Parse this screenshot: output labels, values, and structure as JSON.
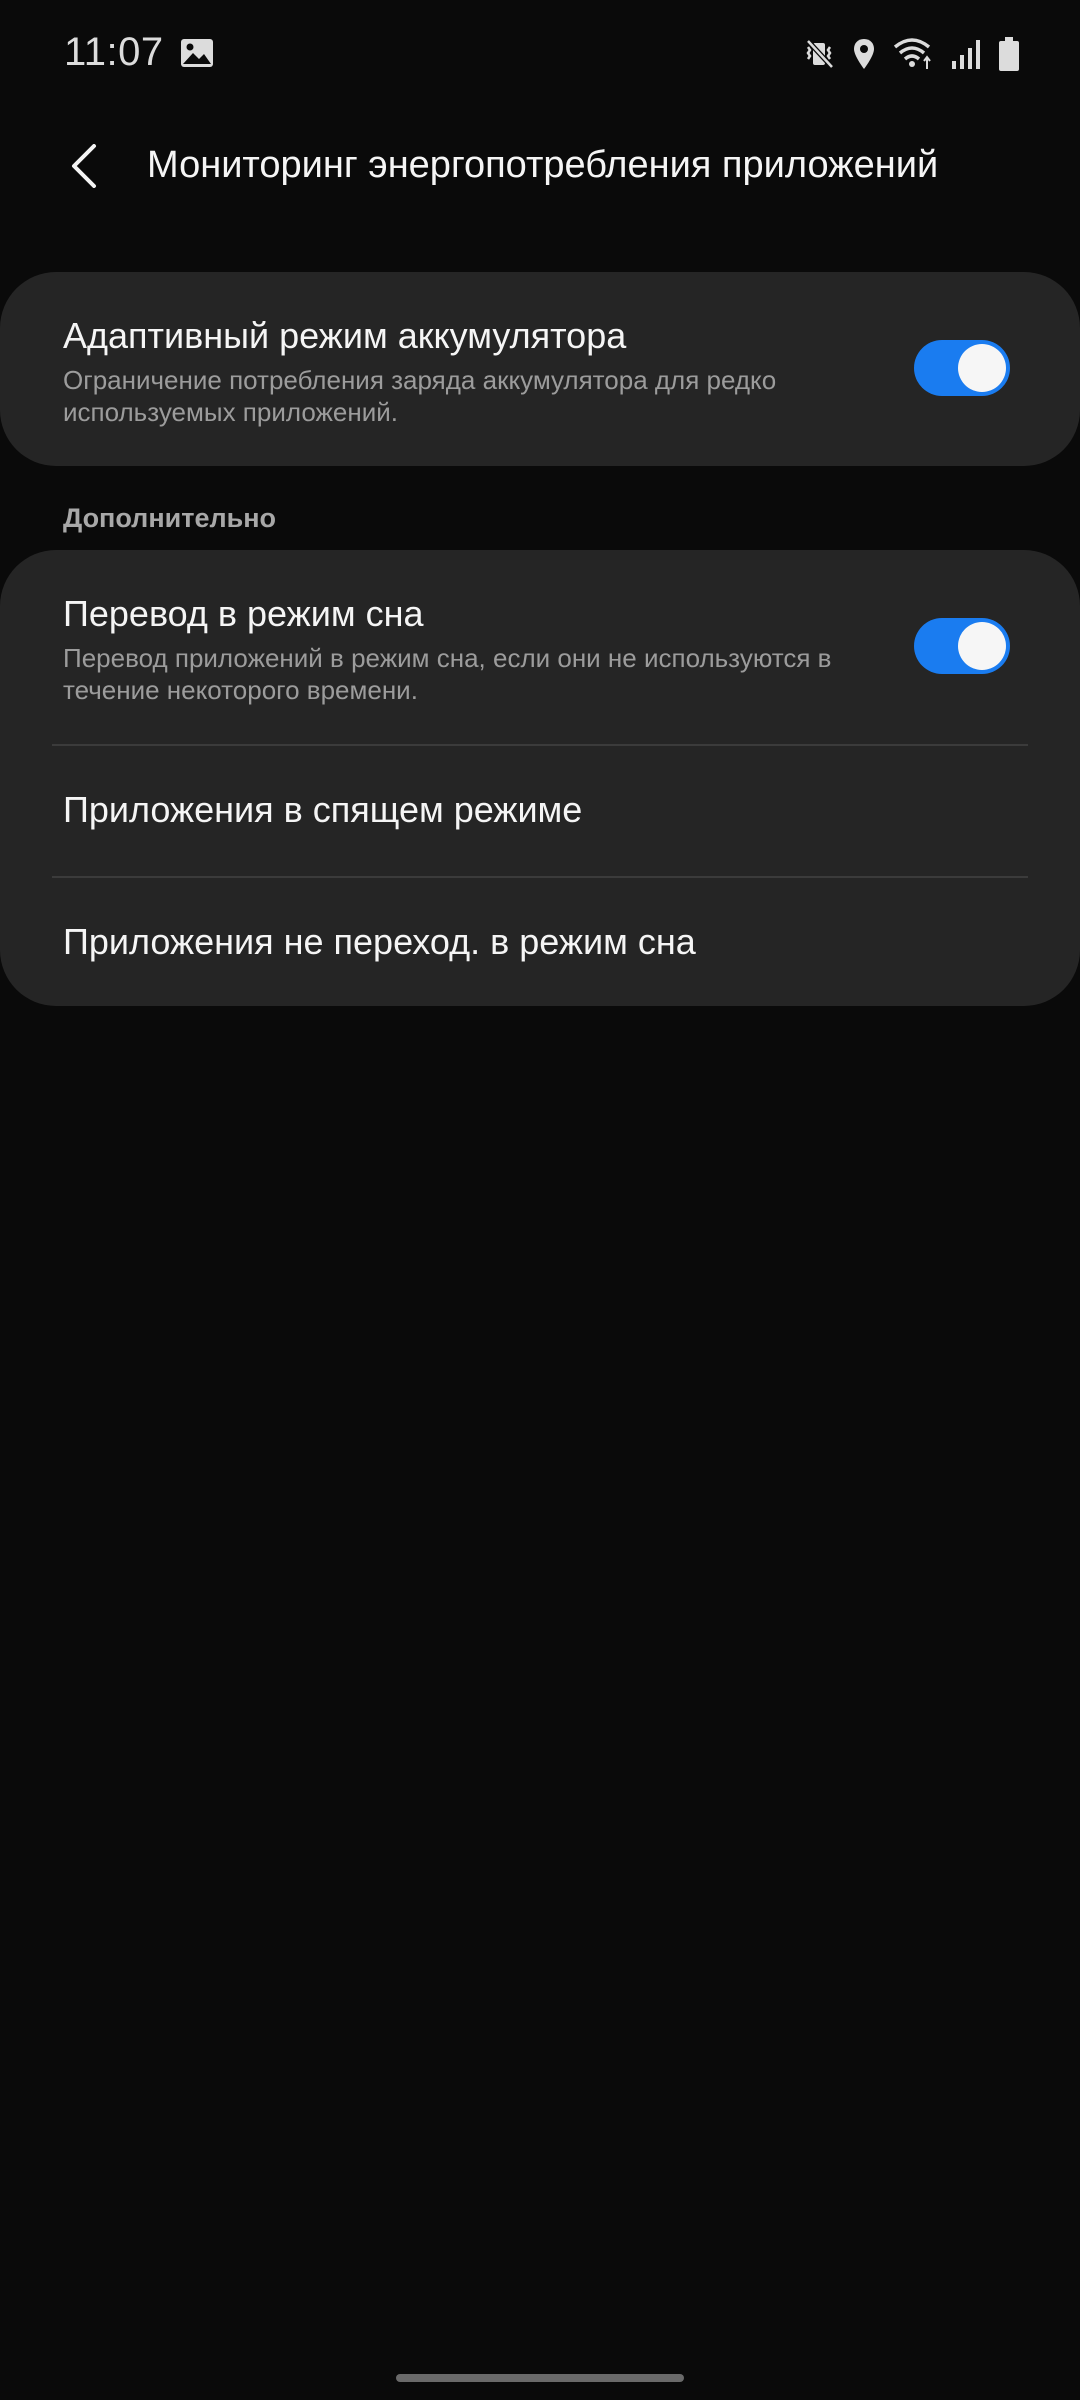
{
  "status_bar": {
    "time": "11:07",
    "icons": [
      "gallery-icon",
      "vibrate-mute-icon",
      "location-icon",
      "wifi-icon",
      "signal-icon",
      "battery-icon"
    ]
  },
  "header": {
    "title": "Мониторинг энергопотребления приложений",
    "back_icon": "chevron-left-icon"
  },
  "adaptive": {
    "title": "Адаптивный режим аккумулятора",
    "description": "Ограничение потребления заряда аккумулятора для редко используемых приложений.",
    "enabled": true
  },
  "section": {
    "title": "Дополнительно"
  },
  "sleep": {
    "title": "Перевод в режим сна",
    "description": "Перевод приложений в режим сна, если они не используются в течение некоторого времени.",
    "enabled": true
  },
  "items": [
    {
      "label": "Приложения в спящем режиме"
    },
    {
      "label": "Приложения не переход. в режим сна"
    }
  ],
  "colors": {
    "background": "#0a0a0a",
    "card": "#252525",
    "accent": "#1a7cf0",
    "secondary_text": "#9c9c9c"
  }
}
